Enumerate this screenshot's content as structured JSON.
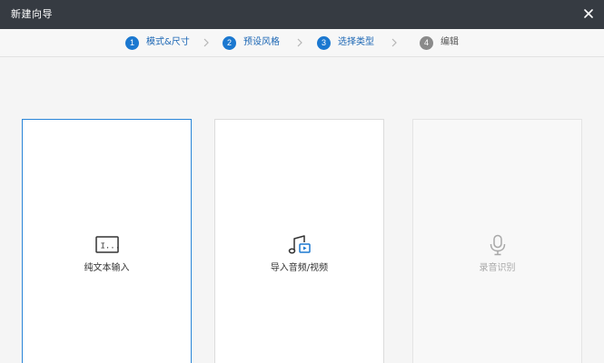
{
  "window": {
    "title": "新建向导",
    "close_icon": "close-icon"
  },
  "steps": [
    {
      "number": "1",
      "label": "模式&尺寸",
      "state": "active"
    },
    {
      "number": "2",
      "label": "预设风格",
      "state": "active"
    },
    {
      "number": "3",
      "label": "选择类型",
      "state": "active"
    },
    {
      "number": "4",
      "label": "编辑",
      "state": "inactive"
    }
  ],
  "options": [
    {
      "label": "纯文本输入",
      "icon": "text-input-icon",
      "icon_text": "I...",
      "state": "selected"
    },
    {
      "label": "导入音频/视频",
      "icon": "music-video-icon",
      "state": "normal"
    },
    {
      "label": "录音识别",
      "icon": "microphone-icon",
      "state": "disabled"
    }
  ],
  "colors": {
    "titlebar": "#363b42",
    "accent": "#1b78d0",
    "inactive_step": "#8a8a8a",
    "selected_border": "#2a86d8",
    "disabled_text": "#a8a8a8"
  }
}
